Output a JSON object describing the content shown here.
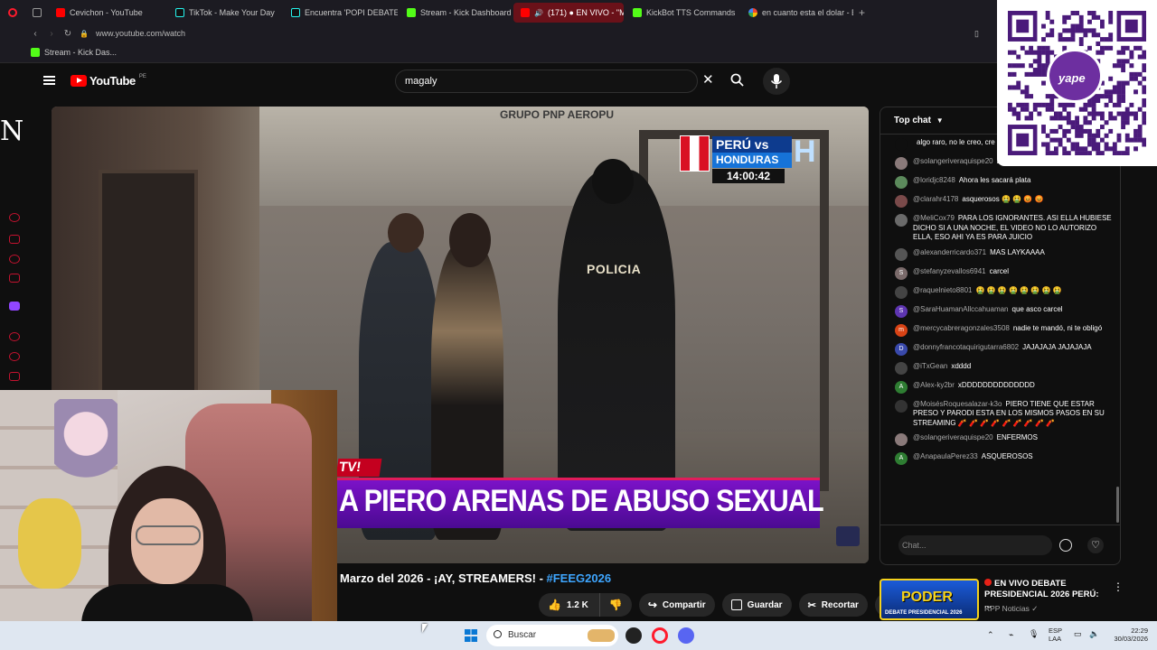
{
  "browser": {
    "tabs": [
      {
        "label": "Cevichon - YouTube",
        "icon": "youtube-icon",
        "active": false
      },
      {
        "label": "TikTok - Make Your Day",
        "icon": "tiktok-icon",
        "active": false
      },
      {
        "label": "Encuentra 'POPI DEBATE'",
        "icon": "tiktok-icon",
        "active": false
      },
      {
        "label": "Stream - Kick Dashboard",
        "icon": "kick-icon",
        "active": false
      },
      {
        "label": "(171) ● EN VIVO - \"M",
        "icon": "youtube-icon",
        "active": true
      },
      {
        "label": "KickBot TTS Commands",
        "icon": "kick-icon",
        "active": false
      },
      {
        "label": "en cuanto esta el dolar - B",
        "icon": "google-icon",
        "active": false
      }
    ],
    "new_tab": "+",
    "url": "www.youtube.com/watch",
    "bookmark": "Stream - Kick Das..."
  },
  "youtube": {
    "logo_text": "YouTube",
    "country_code": "PE",
    "search_value": "magaly",
    "video": {
      "wall_sign": "GRUPO PNP AEROPU",
      "police_label": "POLICIA",
      "score_title": "PERÚ vs",
      "score_sub": "HONDURAS",
      "score_time": "14:00:42",
      "lower_tag": "TV!",
      "lower_text": "A PIERO ARENAS DE ABUSO SEXUAL"
    },
    "title_text": "Marzo del 2026 - ¡AY, STREAMERS! - ",
    "title_hashtag": "#FEEG2026",
    "actions": {
      "likes": "1.2 K",
      "share": "Compartir",
      "save": "Guardar",
      "clip": "Recortar",
      "more": "⋯"
    }
  },
  "chat": {
    "header": "Top chat",
    "messages": [
      {
        "author": "",
        "text": "algo raro, no le creo, cre que la haya grabado si expuesta",
        "avatar": "",
        "color": "#0f0f0f"
      },
      {
        "author": "@solangeriveraquispe20",
        "text": "ENFERMOS",
        "avatar": "",
        "color": "#8a7a7a"
      },
      {
        "author": "@loridjc8248",
        "text": "Ahora les sacará plata",
        "avatar": "",
        "color": "#5c8a5c"
      },
      {
        "author": "@clarahr4178",
        "text": "asquerosos 🤮 🤮 😡 😡",
        "avatar": "",
        "color": "#7a4a4a"
      },
      {
        "author": "@MeliCox79",
        "text": "PARA LOS IGNORANTES. ASI ELLA HUBIESE DICHO SI A UNA NOCHE, EL VIDEO NO LO AUTORIZO ELLA, ESO AHI YA ES PARA JUICIO",
        "avatar": "",
        "color": "#6a6a6a"
      },
      {
        "author": "@alexanderricardo371",
        "text": "MAS LAYKAAAA",
        "avatar": "",
        "color": "#555"
      },
      {
        "author": "@stefanyzevallos6941",
        "text": "carcel",
        "avatar": "S",
        "color": "#7a6a6a"
      },
      {
        "author": "@raquelnieto8801",
        "text": "🤮 🤮 🤮 🤮 🤮 🤮 🤮 🤮",
        "avatar": "",
        "color": "#444"
      },
      {
        "author": "@SaraHuamanAllccahuaman",
        "text": "que asco carcel",
        "avatar": "S",
        "color": "#5e35b1"
      },
      {
        "author": "@mercycabreragonzales3508",
        "text": "nadie te mandó, ni te obligó",
        "avatar": "m",
        "color": "#d84315"
      },
      {
        "author": "@donnyfrancotaquirigutarra6802",
        "text": "JAJAJAJA JAJAJAJA",
        "avatar": "D",
        "color": "#3949ab"
      },
      {
        "author": "@iTxGean",
        "text": "xdddd",
        "avatar": "",
        "color": "#444"
      },
      {
        "author": "@Alex-ky2br",
        "text": "xDDDDDDDDDDDDDD",
        "avatar": "A",
        "color": "#2e7d32"
      },
      {
        "author": "@MoisésRoquesalazar-k3o",
        "text": "PIERO TIENE QUE ESTAR PRESO Y PARODI ESTA EN LOS MISMOS PASOS EN SU STREAMING 🧨 🧨 🧨 🧨 🧨 🧨 🧨 🧨 🧨",
        "avatar": "",
        "color": "#333"
      },
      {
        "author": "@solangeriveraquispe20",
        "text": "ENFERMOS",
        "avatar": "",
        "color": "#8a7a7a"
      },
      {
        "author": "@AnapaulaPerez33",
        "text": "ASQUEROSOS",
        "avatar": "A",
        "color": "#2e7d32"
      }
    ],
    "input_placeholder": "Chat..."
  },
  "recommendation": {
    "thumb_text": "PODER",
    "thumb_sub": "DEBATE PRESIDENCIAL 2026",
    "title": "EN VIVO DEBATE PRESIDENCIAL 2026 PERÚ: ...",
    "channel": "RPP Noticias ✓"
  },
  "qr": {
    "logo_text": "yape"
  },
  "overlay_letter": "N",
  "taskbar": {
    "search_placeholder": "Buscar",
    "tray": "⌃",
    "lang_line1": "ESP",
    "lang_line2": "LAA",
    "time": "22:29",
    "date": "30/03/2026"
  }
}
